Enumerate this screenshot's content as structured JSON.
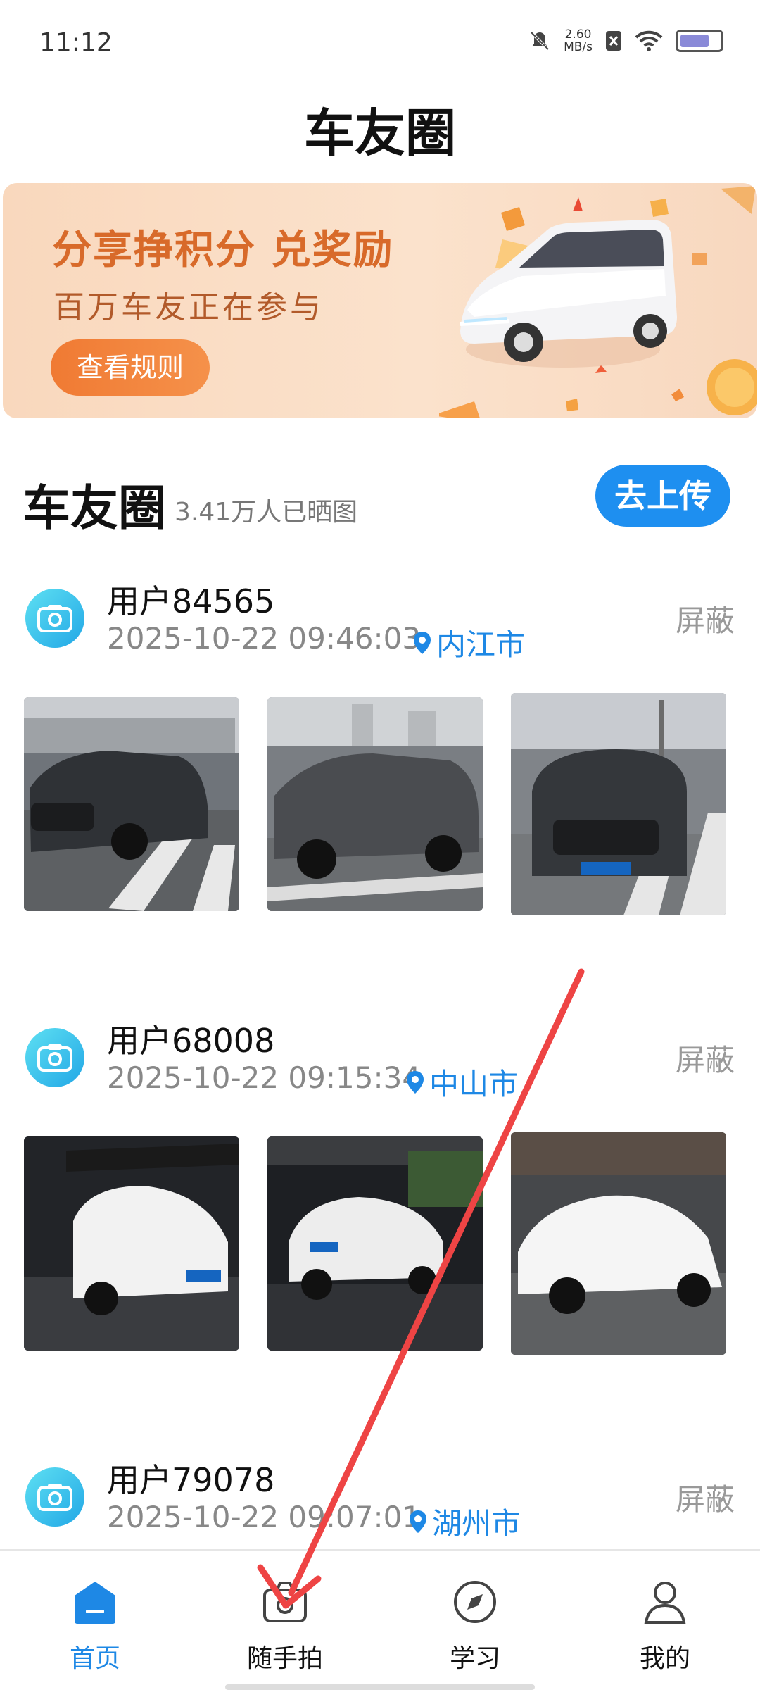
{
  "status_bar": {
    "time": "11:12",
    "speed_value": "2.60",
    "speed_unit": "MB/s"
  },
  "page_title": "车友圈",
  "banner": {
    "title": "分享挣积分 兑奖励",
    "subtitle": "百万车友正在参与",
    "button_label": "查看规则"
  },
  "section": {
    "title": "车友圈",
    "count_text": "3.41万人已晒图",
    "upload_label": "去上传"
  },
  "posts": [
    {
      "user": "用户84565",
      "time": "2025-10-22 09:46:03",
      "location": "内江市",
      "block_label": "屏蔽"
    },
    {
      "user": "用户68008",
      "time": "2025-10-22 09:15:34",
      "location": "中山市",
      "block_label": "屏蔽"
    },
    {
      "user": "用户79078",
      "time": "2025-10-22 09:07:01",
      "location": "湖州市",
      "block_label": "屏蔽"
    }
  ],
  "tabbar": {
    "items": [
      {
        "label": "首页",
        "icon": "home-icon",
        "active": true
      },
      {
        "label": "随手拍",
        "icon": "camera-icon"
      },
      {
        "label": "学习",
        "icon": "compass-icon"
      },
      {
        "label": "我的",
        "icon": "person-icon"
      }
    ]
  },
  "colors": {
    "accent": "#1e88e5",
    "upload_button": "#1e8ff0",
    "banner_title": "#d86a2a",
    "annotation_arrow": "#ee4444"
  }
}
